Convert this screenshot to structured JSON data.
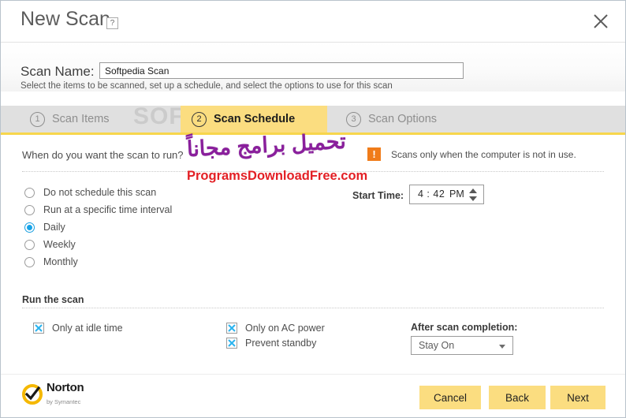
{
  "window": {
    "title": "New Scan",
    "help_badge": "?",
    "close_label": "×"
  },
  "scan_name": {
    "label": "Scan Name:",
    "value": "Softpedia Scan",
    "placeholder": "Scan Name",
    "subtitle": "Select the items to be scanned, set up a schedule, and select the options to use for this scan"
  },
  "tabs": [
    {
      "number": "1",
      "label": "Scan Items",
      "active": false
    },
    {
      "number": "2",
      "label": "Scan Schedule",
      "active": true
    },
    {
      "number": "3",
      "label": "Scan Options",
      "active": false
    }
  ],
  "schedule": {
    "question": "When do you want the scan to run?",
    "warning_icon": "!",
    "warning_text": "Scans only when the computer is not in use.",
    "options": [
      {
        "label": "Do not schedule this scan",
        "selected": false
      },
      {
        "label": "Run at a specific time interval",
        "selected": false
      },
      {
        "label": "Daily",
        "selected": true
      },
      {
        "label": "Weekly",
        "selected": false
      },
      {
        "label": "Monthly",
        "selected": false
      }
    ],
    "start_time_label": "Start Time:",
    "start_time_value": "4 : 42",
    "start_time_meridiem": "PM"
  },
  "run_the_scan": {
    "section_title": "Run the scan",
    "checkboxes": [
      {
        "label": "Only at idle time",
        "checked": true
      },
      {
        "label": "Only on AC power",
        "checked": true
      },
      {
        "label": "Prevent standby",
        "checked": true
      }
    ],
    "after_scan_label": "After scan completion:",
    "after_scan_value": "Stay On",
    "after_scan_options": [
      "Stay On"
    ]
  },
  "footer": {
    "brand_name": "Norton",
    "brand_tagline": "by Symantec",
    "buttons": {
      "cancel": "Cancel",
      "back": "Back",
      "next": "Next"
    }
  },
  "watermarks": {
    "softpedia": "SOFTPEDIA",
    "arabic": "تحميل برامج مجاناً",
    "url": "ProgramsDownloadFree.com"
  },
  "colors": {
    "accent_yellow": "#fbdd80",
    "tab_underline": "#f7d64c",
    "checkbox_cyan": "#2bb3ef",
    "radio_blue": "#17a3e8",
    "warning_orange": "#f07c1a",
    "watermark_purple": "#8a1f9c",
    "watermark_red": "#e32025"
  }
}
